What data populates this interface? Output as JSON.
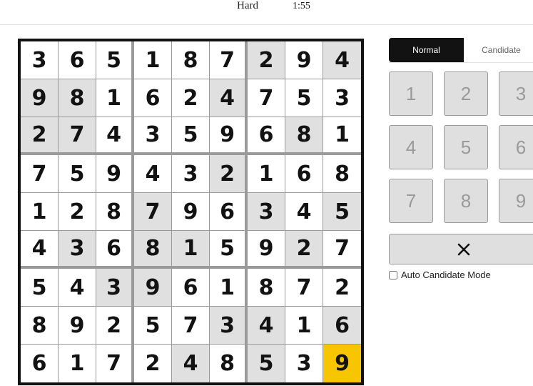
{
  "header": {
    "difficulty": "Hard",
    "timer": "1:55"
  },
  "board": {
    "rows": [
      [
        3,
        6,
        5,
        1,
        8,
        7,
        2,
        9,
        4
      ],
      [
        9,
        8,
        1,
        6,
        2,
        4,
        7,
        5,
        3
      ],
      [
        2,
        7,
        4,
        3,
        5,
        9,
        6,
        8,
        1
      ],
      [
        7,
        5,
        9,
        4,
        3,
        2,
        1,
        6,
        8
      ],
      [
        1,
        2,
        8,
        7,
        9,
        6,
        3,
        4,
        5
      ],
      [
        4,
        3,
        6,
        8,
        1,
        5,
        9,
        2,
        7
      ],
      [
        5,
        4,
        3,
        9,
        6,
        1,
        8,
        7,
        2
      ],
      [
        8,
        9,
        2,
        5,
        7,
        3,
        4,
        1,
        6
      ],
      [
        6,
        1,
        7,
        2,
        4,
        8,
        5,
        3,
        9
      ]
    ],
    "shaded": [
      [
        0,
        6
      ],
      [
        0,
        8
      ],
      [
        1,
        0
      ],
      [
        1,
        1
      ],
      [
        1,
        5
      ],
      [
        2,
        0
      ],
      [
        2,
        1
      ],
      [
        2,
        7
      ],
      [
        3,
        5
      ],
      [
        4,
        3
      ],
      [
        4,
        6
      ],
      [
        4,
        8
      ],
      [
        5,
        1
      ],
      [
        5,
        3
      ],
      [
        5,
        4
      ],
      [
        5,
        7
      ],
      [
        6,
        2
      ],
      [
        6,
        3
      ],
      [
        7,
        5
      ],
      [
        7,
        6
      ],
      [
        7,
        8
      ],
      [
        8,
        4
      ],
      [
        8,
        6
      ]
    ],
    "selected": [
      8,
      8
    ],
    "colors": {
      "selected": "#f7c600",
      "shaded": "#e0e0e0"
    }
  },
  "mode": {
    "normal_label": "Normal",
    "candidate_label": "Candidate",
    "active": "Normal"
  },
  "numpad": {
    "keys": [
      "1",
      "2",
      "3",
      "4",
      "5",
      "6",
      "7",
      "8",
      "9"
    ],
    "clear_icon": "close-icon"
  },
  "auto_candidate": {
    "label": "Auto Candidate Mode",
    "checked": false
  }
}
